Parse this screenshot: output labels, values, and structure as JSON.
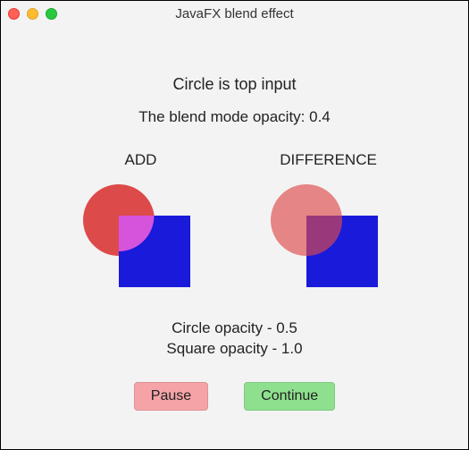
{
  "window": {
    "title": "JavaFX blend effect"
  },
  "main": {
    "top_input_label": "Circle is top input",
    "opacity_label": "The blend mode opacity: 0.4"
  },
  "demos": [
    {
      "label": "ADD",
      "mode": "ADD"
    },
    {
      "label": "DIFFERENCE",
      "mode": "DIFFERENCE"
    }
  ],
  "shape_info": {
    "circle_opacity_label": "Circle opacity - 0.5",
    "square_opacity_label": "Square opacity - 1.0"
  },
  "buttons": {
    "pause": "Pause",
    "continue": "Continue"
  },
  "colors": {
    "circle": "#dd4a4a",
    "square": "#1a1ada",
    "pause_button": "#f5a3a7",
    "continue_button": "#8ee08e"
  }
}
